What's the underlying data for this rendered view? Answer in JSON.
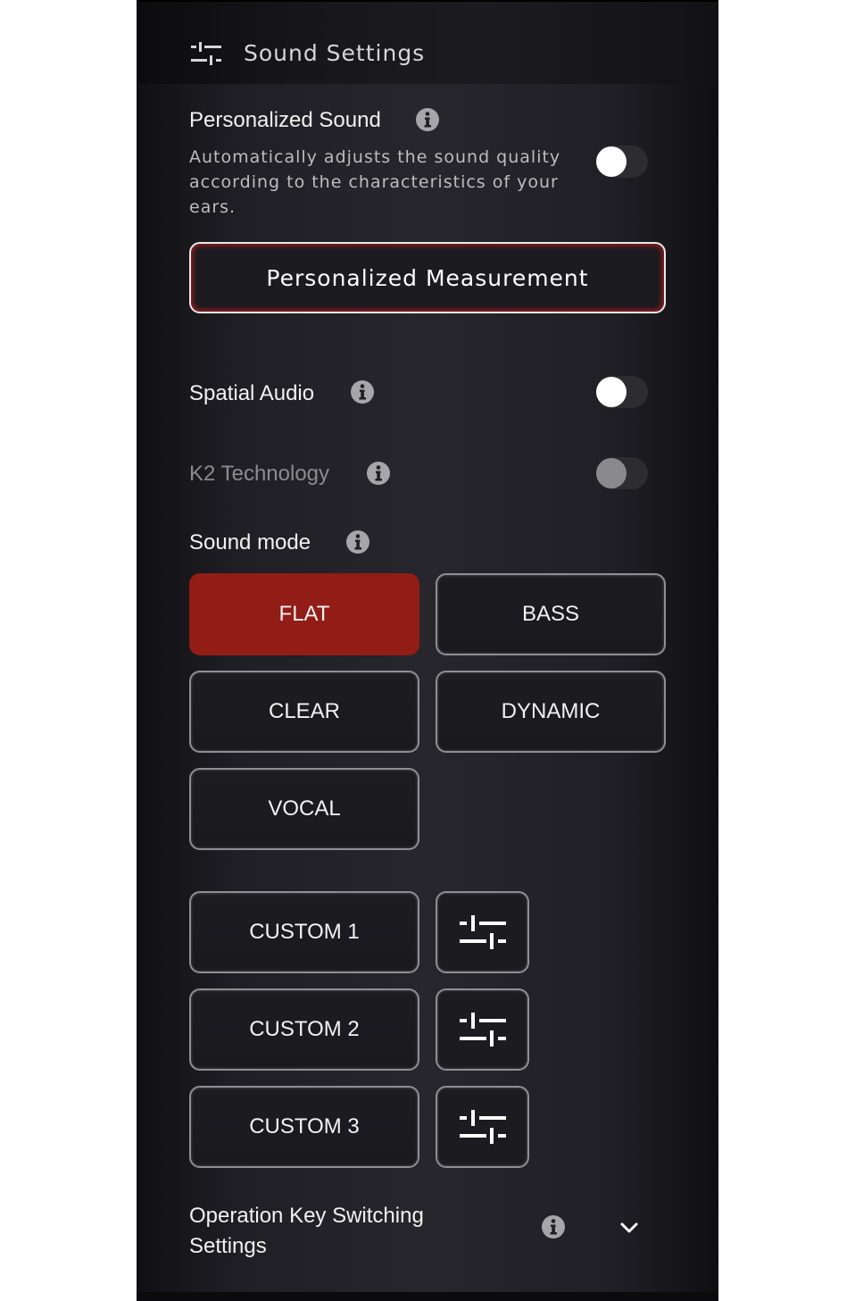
{
  "header": {
    "title": "Sound Settings",
    "icon": "sliders-icon"
  },
  "personalized_sound": {
    "label": "Personalized Sound",
    "description_lines": [
      "Automatically adjusts the sound quality",
      "according to the characteristics of your",
      "ears."
    ],
    "enabled": false
  },
  "measurement_button": {
    "label": "Personalized Measurement"
  },
  "spatial_audio": {
    "label": "Spatial Audio",
    "enabled": false
  },
  "k2_technology": {
    "label": "K2 Technology",
    "enabled": false,
    "available": false
  },
  "sound_mode": {
    "label": "Sound mode",
    "selected": "FLAT",
    "modes": [
      "FLAT",
      "BASS",
      "CLEAR",
      "DYNAMIC",
      "VOCAL"
    ],
    "custom": [
      "CUSTOM 1",
      "CUSTOM 2",
      "CUSTOM 3"
    ]
  },
  "operation_key": {
    "label_lines": [
      "Operation Key Switching",
      "Settings"
    ]
  },
  "colors": {
    "accent": "#921c16",
    "background": "#1f1f25",
    "text": "#f2f2f2"
  }
}
